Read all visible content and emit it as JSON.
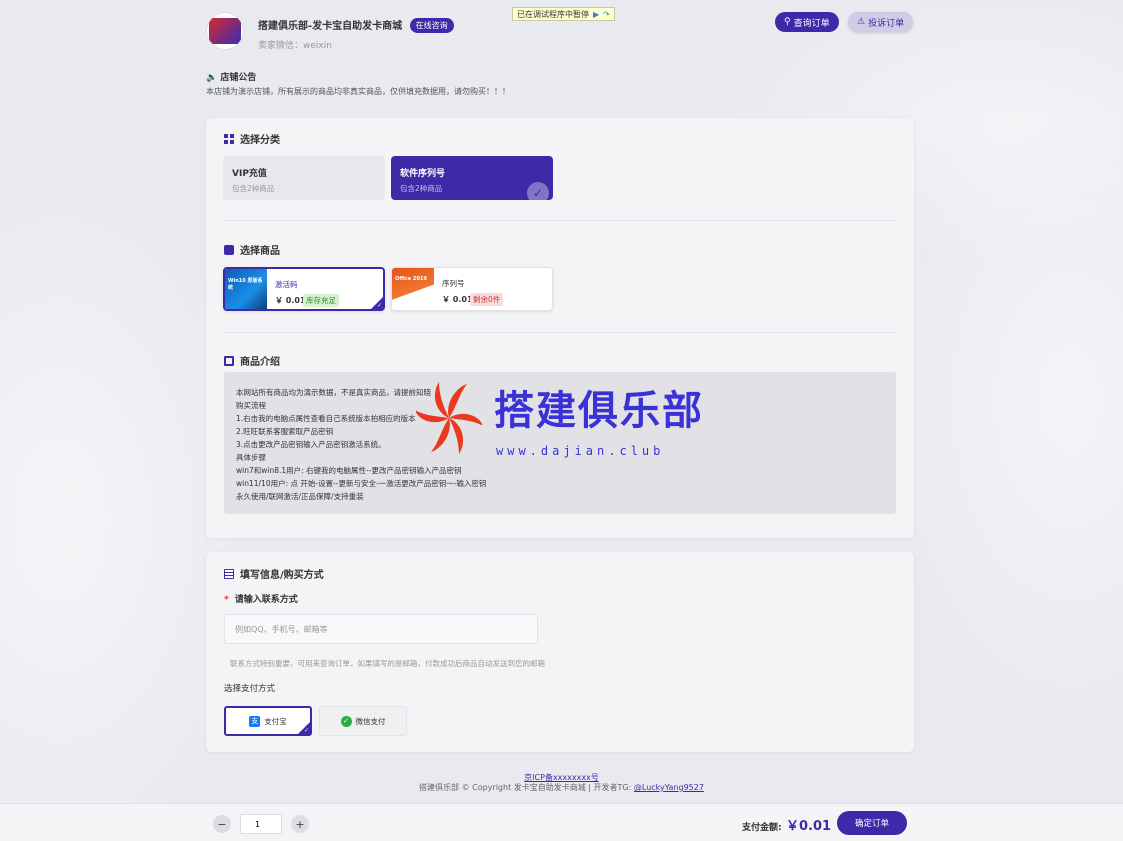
{
  "debug_bar": {
    "text": "已在调试程序中暂停",
    "resume_icon": "play-icon",
    "step_icon": "step-over-icon"
  },
  "header": {
    "logo_icon": "shop-logo",
    "title": "搭建俱乐部-发卡宝自助发卡商城",
    "consult_label": "在线咨询",
    "seller_wechat": "卖家微信：weixin",
    "query_label": "查询订单",
    "complain_label": "投诉订单"
  },
  "notice": {
    "title": "店铺公告",
    "text": "本店铺为演示店铺，所有展示的商品均非真实商品，仅供填充数据用，请勿购买！！！"
  },
  "category": {
    "title": "选择分类",
    "items": [
      {
        "name": "VIP充值",
        "count": "包含2种商品",
        "selected": false
      },
      {
        "name": "软件序列号",
        "count": "包含2种商品",
        "selected": true
      }
    ]
  },
  "products": {
    "title": "选择商品",
    "items": [
      {
        "name": "激活码",
        "price": "￥ 0.01",
        "stock": "库存充足",
        "thumb_label": "Win10 原版系统",
        "selected": true
      },
      {
        "name": "序列号",
        "price": "￥ 0.01",
        "stock": "剩余0件",
        "thumb_label": "Office 2019",
        "selected": false
      }
    ]
  },
  "intro": {
    "title": "商品介绍",
    "lines": [
      "本网站所有商品均为演示数据，不是真实商品，请提前知晓",
      "购买流程",
      "1.右击我的电脑点属性查看自己系统版本拍相应的版本",
      "2.旺旺联系客服索取产品密钥",
      "3.点击更改产品密钥输入产品密钥激活系统。",
      "具体步骤",
      "win7和win8.1用户: 右键我的电脑属性--更改产品密钥输入产品密钥",
      "win11/10用户: 点 开始-设置--更新与安全-一激活更改产品密钥一-输入密钥",
      "永久使用/联网激活/正品保障/支持重装"
    ]
  },
  "watermark": {
    "text": "搭建俱乐部",
    "url": "www.dajian.club"
  },
  "form": {
    "title": "填写信息/购买方式",
    "contact_label": "请输入联系方式",
    "contact_placeholder": "例如QQ、手机号、邮箱等",
    "contact_value": "",
    "hint": "联系方式特别重要，可用来查询订单，如果填写的是邮箱，付款成功后商品自动发送到您的邮箱",
    "pay_label": "选择支付方式",
    "pay_methods": [
      {
        "name": "支付宝",
        "icon": "alipay-icon",
        "selected": true
      },
      {
        "name": "微信支付",
        "icon": "wechat-pay-icon",
        "selected": false
      }
    ]
  },
  "footer": {
    "icp": "京ICP备xxxxxxxx号",
    "copyright": "搭建俱乐部 © Copyright 发卡宝自助发卡商城 | 开发者TG:",
    "tg": "@LuckyYang9527"
  },
  "bottom_bar": {
    "quantity": "1",
    "total_label": "支付金额:",
    "total": "￥0.01",
    "confirm_label": "确定订单"
  },
  "colors": {
    "accent": "#3d2aa8",
    "stock_ok": "#2e8b2e",
    "stock_low": "#d03a3a",
    "watermark_blue": "#3a32d6",
    "watermark_red": "#e83a1f"
  }
}
